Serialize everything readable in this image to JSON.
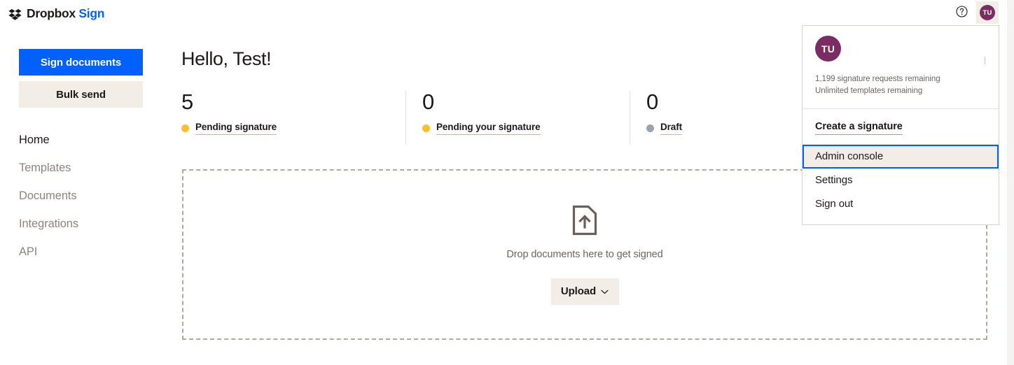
{
  "header": {
    "brand_mark": "dropbox-logo-icon",
    "brand_name": "Dropbox",
    "brand_product": "Sign",
    "help_icon": "help-circle-icon",
    "avatar_initials": "TU"
  },
  "sidebar": {
    "primary_button": "Sign documents",
    "secondary_button": "Bulk send",
    "nav_items": [
      {
        "label": "Home",
        "active": true
      },
      {
        "label": "Templates",
        "active": false
      },
      {
        "label": "Documents",
        "active": false
      },
      {
        "label": "Integrations",
        "active": false
      },
      {
        "label": "API",
        "active": false
      }
    ]
  },
  "main": {
    "greeting": "Hello, Test!",
    "stats": [
      {
        "value": "5",
        "label": "Pending signature",
        "dot_color": "#fbc02d"
      },
      {
        "value": "0",
        "label": "Pending your signature",
        "dot_color": "#fbc02d"
      },
      {
        "value": "0",
        "label": "Draft",
        "dot_color": "#9aa3ab"
      }
    ],
    "dropzone": {
      "icon": "document-upload-icon",
      "text": "Drop documents here to get signed",
      "upload_button": "Upload",
      "upload_chevron": "chevron-down-icon"
    }
  },
  "dropdown": {
    "avatar_initials": "TU",
    "quota_signatures": "1,199 signature requests remaining",
    "quota_templates": "Unlimited templates remaining",
    "create_signature": "Create a signature",
    "menu_items": [
      {
        "label": "Admin console",
        "focused": true
      },
      {
        "label": "Settings",
        "focused": false
      },
      {
        "label": "Sign out",
        "focused": false
      }
    ]
  },
  "colors": {
    "brand_blue": "#0061ff",
    "beige": "#f3ede8",
    "avatar_purple": "#7b2c63",
    "text_dark": "#1e1919",
    "text_muted": "#8a8580",
    "dashed_border": "#b0a9a2",
    "focus_blue": "#0061ff"
  }
}
